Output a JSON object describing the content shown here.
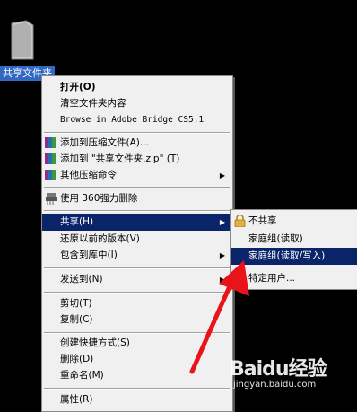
{
  "desktop": {
    "folder_label": "共享文件夹"
  },
  "context_menu": {
    "items": [
      {
        "label": "打开(O)",
        "bold": true
      },
      {
        "label": "清空文件夹内容"
      },
      {
        "label": "Browse in Adobe Bridge CS5.1",
        "mono": true
      },
      {
        "label": "添加到压缩文件(A)..."
      },
      {
        "label": "添加到 \"共享文件夹.zip\" (T)"
      },
      {
        "label": "其他压缩命令",
        "submenu": true
      },
      {
        "label": "使用 360强力删除"
      },
      {
        "label": "共享(H)",
        "submenu": true,
        "highlighted": true
      },
      {
        "label": "还原以前的版本(V)"
      },
      {
        "label": "包含到库中(I)",
        "submenu": true
      },
      {
        "label": "发送到(N)",
        "submenu": true
      },
      {
        "label": "剪切(T)"
      },
      {
        "label": "复制(C)"
      },
      {
        "label": "创建快捷方式(S)"
      },
      {
        "label": "删除(D)"
      },
      {
        "label": "重命名(M)"
      },
      {
        "label": "属性(R)"
      }
    ]
  },
  "share_submenu": {
    "items": [
      {
        "label": "不共享"
      },
      {
        "label": "家庭组(读取)"
      },
      {
        "label": "家庭组(读取/写入)",
        "highlighted": true
      },
      {
        "label": "特定用户..."
      }
    ]
  },
  "watermark": {
    "brand": "Baidu经验",
    "url": "jingyan.baidu.com"
  }
}
